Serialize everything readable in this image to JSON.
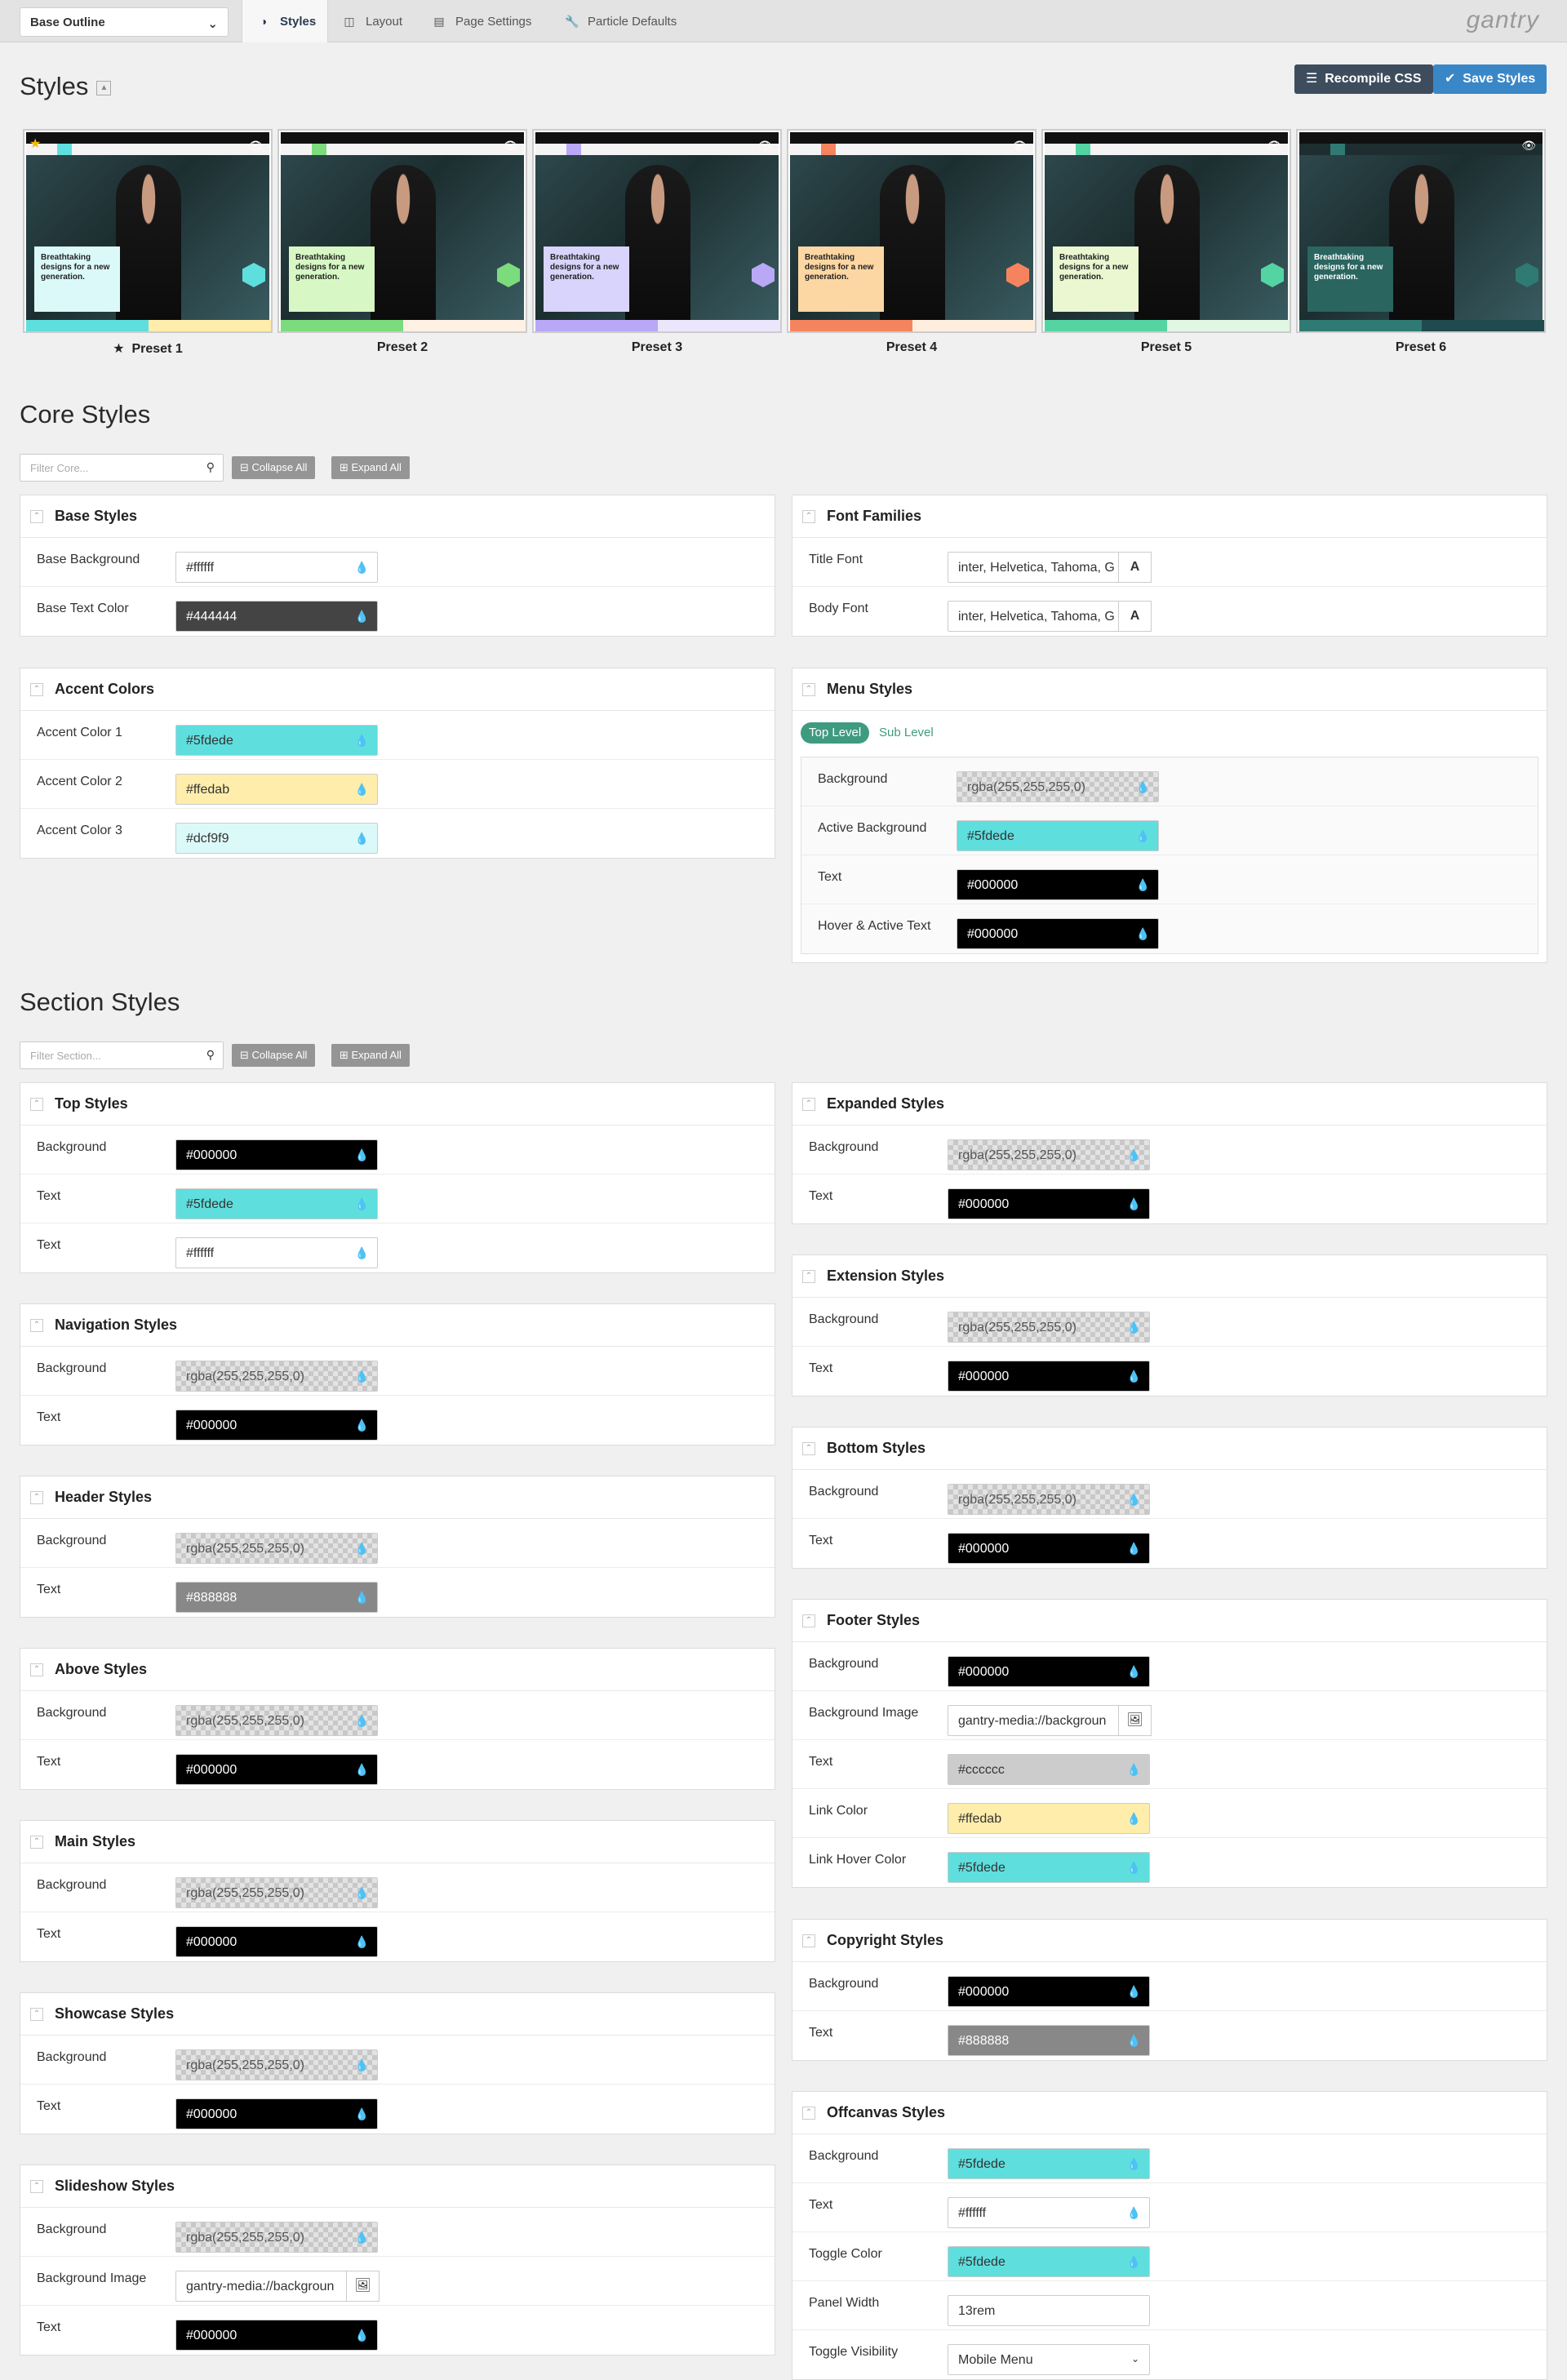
{
  "topbar": {
    "outline": "Base Outline",
    "tabs": [
      "Styles",
      "Layout",
      "Page Settings",
      "Particle Defaults"
    ],
    "logo": "gantry"
  },
  "styles_header": {
    "title": "Styles",
    "recompile": "Recompile CSS",
    "save": "Save Styles"
  },
  "presets": [
    {
      "label": "Preset 1",
      "accent1": "#5fdede",
      "accent2": "#ffedab",
      "card": "#dcf9f9"
    },
    {
      "label": "Preset 2",
      "accent1": "#7cdb7c",
      "accent2": "#fff1e4",
      "card": "#d7f8c4"
    },
    {
      "label": "Preset 3",
      "accent1": "#b8a8f5",
      "accent2": "#ece6fd",
      "card": "#d8d4fb"
    },
    {
      "label": "Preset 4",
      "accent1": "#f5845e",
      "accent2": "#ffeede",
      "card": "#fdd7a3"
    },
    {
      "label": "Preset 5",
      "accent1": "#54d4a3",
      "accent2": "#e1f7e4",
      "card": "#eaf7d1"
    },
    {
      "label": "Preset 6",
      "accent1": "#2f7a72",
      "accent2": "#1f4a4e",
      "card": "#2a6560"
    }
  ],
  "preset_card_text": "Breathtaking designs for a new generation.",
  "core": {
    "title": "Core Styles",
    "filter": "Filter Core...",
    "collapse": "Collapse All",
    "expand": "Expand All"
  },
  "base_styles": {
    "title": "Base Styles",
    "rows": [
      {
        "label": "Base Background",
        "value": "#ffffff"
      },
      {
        "label": "Base Text Color",
        "value": "#444444"
      }
    ]
  },
  "accent_colors": {
    "title": "Accent Colors",
    "rows": [
      {
        "label": "Accent Color 1",
        "value": "#5fdede"
      },
      {
        "label": "Accent Color 2",
        "value": "#ffedab"
      },
      {
        "label": "Accent Color 3",
        "value": "#dcf9f9"
      }
    ]
  },
  "font_families": {
    "title": "Font Families",
    "rows": [
      {
        "label": "Title Font",
        "value": "inter, Helvetica, Tahoma, G"
      },
      {
        "label": "Body Font",
        "value": "inter, Helvetica, Tahoma, G"
      }
    ]
  },
  "menu_styles": {
    "title": "Menu Styles",
    "top_level": "Top Level",
    "sub_level": "Sub Level",
    "rows": [
      {
        "label": "Background",
        "value": "rgba(255,255,255,0)"
      },
      {
        "label": "Active Background",
        "value": "#5fdede"
      },
      {
        "label": "Text",
        "value": "#000000"
      },
      {
        "label": "Hover & Active Text",
        "value": "#000000"
      }
    ]
  },
  "section": {
    "title": "Section Styles",
    "filter": "Filter Section...",
    "collapse": "Collapse All",
    "expand": "Expand All"
  },
  "top_styles": {
    "title": "Top Styles",
    "rows": [
      {
        "label": "Background",
        "value": "#000000"
      },
      {
        "label": "Text",
        "value": "#5fdede"
      },
      {
        "label": "Text",
        "value": "#ffffff"
      }
    ]
  },
  "navigation_styles": {
    "title": "Navigation Styles",
    "rows": [
      {
        "label": "Background",
        "value": "rgba(255,255,255,0)"
      },
      {
        "label": "Text",
        "value": "#000000"
      }
    ]
  },
  "header_styles": {
    "title": "Header Styles",
    "rows": [
      {
        "label": "Background",
        "value": "rgba(255,255,255,0)"
      },
      {
        "label": "Text",
        "value": "#888888"
      }
    ]
  },
  "above_styles": {
    "title": "Above Styles",
    "rows": [
      {
        "label": "Background",
        "value": "rgba(255,255,255,0)"
      },
      {
        "label": "Text",
        "value": "#000000"
      }
    ]
  },
  "main_styles": {
    "title": "Main Styles",
    "rows": [
      {
        "label": "Background",
        "value": "rgba(255,255,255,0)"
      },
      {
        "label": "Text",
        "value": "#000000"
      }
    ]
  },
  "showcase_styles": {
    "title": "Showcase Styles",
    "rows": [
      {
        "label": "Background",
        "value": "rgba(255,255,255,0)"
      },
      {
        "label": "Text",
        "value": "#000000"
      }
    ]
  },
  "slideshow_styles": {
    "title": "Slideshow Styles",
    "rows": [
      {
        "label": "Background",
        "value": "rgba(255,255,255,0)"
      },
      {
        "label": "Background Image",
        "value": "gantry-media://backgroun"
      },
      {
        "label": "Text",
        "value": "#000000"
      }
    ]
  },
  "expanded_styles": {
    "title": "Expanded Styles",
    "rows": [
      {
        "label": "Background",
        "value": "rgba(255,255,255,0)"
      },
      {
        "label": "Text",
        "value": "#000000"
      }
    ]
  },
  "extension_styles": {
    "title": "Extension Styles",
    "rows": [
      {
        "label": "Background",
        "value": "rgba(255,255,255,0)"
      },
      {
        "label": "Text",
        "value": "#000000"
      }
    ]
  },
  "bottom_styles": {
    "title": "Bottom Styles",
    "rows": [
      {
        "label": "Background",
        "value": "rgba(255,255,255,0)"
      },
      {
        "label": "Text",
        "value": "#000000"
      }
    ]
  },
  "footer_styles": {
    "title": "Footer Styles",
    "rows": [
      {
        "label": "Background",
        "value": "#000000"
      },
      {
        "label": "Background Image",
        "value": "gantry-media://backgroun"
      },
      {
        "label": "Text",
        "value": "#cccccc"
      },
      {
        "label": "Link Color",
        "value": "#ffedab"
      },
      {
        "label": "Link Hover Color",
        "value": "#5fdede"
      }
    ]
  },
  "copyright_styles": {
    "title": "Copyright Styles",
    "rows": [
      {
        "label": "Background",
        "value": "#000000"
      },
      {
        "label": "Text",
        "value": "#888888"
      }
    ]
  },
  "offcanvas_styles": {
    "title": "Offcanvas Styles",
    "rows": [
      {
        "label": "Background",
        "value": "#5fdede"
      },
      {
        "label": "Text",
        "value": "#ffffff"
      },
      {
        "label": "Toggle Color",
        "value": "#5fdede"
      },
      {
        "label": "Panel Width",
        "value": "13rem"
      },
      {
        "label": "Toggle Visibility",
        "value": "Mobile Menu"
      }
    ]
  }
}
